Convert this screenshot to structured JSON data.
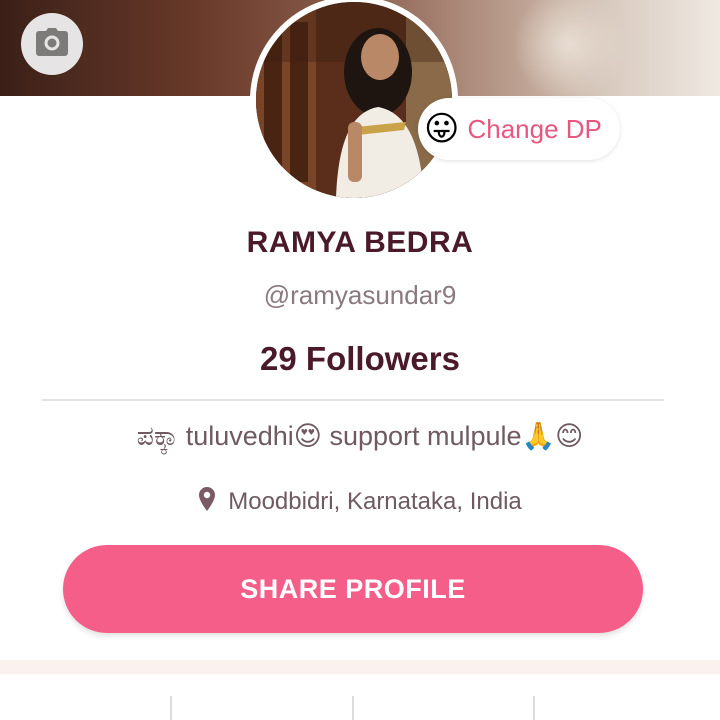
{
  "profile": {
    "change_dp_emoji": "😛",
    "change_dp_label": "Change DP",
    "name": "RAMYA BEDRA",
    "handle": "@ramyasundar9",
    "followers": "29 Followers",
    "bio": "ಪಕ್ಕಾ tuluvedhi😍 support mulpule🙏😊",
    "location": "Moodbidri, Karnataka, India"
  },
  "actions": {
    "share_label": "SHARE PROFILE"
  },
  "icons": {
    "camera": "camera-icon",
    "location": "location-pin-icon"
  },
  "colors": {
    "accent": "#f45e89",
    "change_dp_text": "#e8577f",
    "name_text": "#4a1a2a",
    "secondary_text": "#6e5a60"
  }
}
